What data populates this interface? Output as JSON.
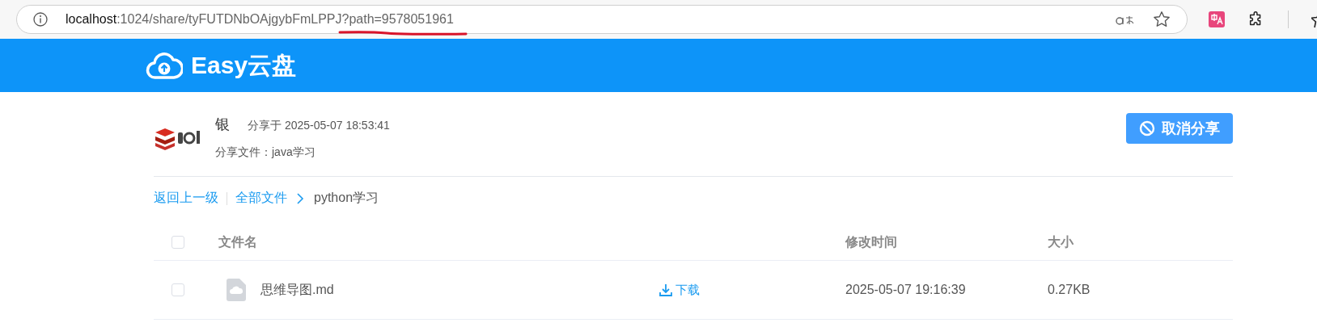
{
  "browser": {
    "url": {
      "host": "localhost",
      "path": ":1024/share/tyFUTDNbOAjgybFmLPPJ",
      "query": "?path=9578051961",
      "query_underlined": true
    }
  },
  "header": {
    "logo_text": "Easy云盘"
  },
  "share_info": {
    "user_name": "银",
    "share_time": "分享于 2025-05-07 18:53:41",
    "shared_file": "分享文件：java学习",
    "cancel_button": "取消分享"
  },
  "breadcrumb": {
    "back": "返回上一级",
    "items": [
      {
        "label": "全部文件",
        "link": true
      },
      {
        "label": "python学习",
        "link": false
      }
    ]
  },
  "table": {
    "all_checked": false,
    "columns": [
      "文件名",
      "修改时间",
      "大小"
    ],
    "rows": [
      {
        "checked": false,
        "name": "思维导图.md",
        "action": "下载",
        "modified": "2025-05-07 19:16:39",
        "size": "0.27KB"
      }
    ]
  }
}
